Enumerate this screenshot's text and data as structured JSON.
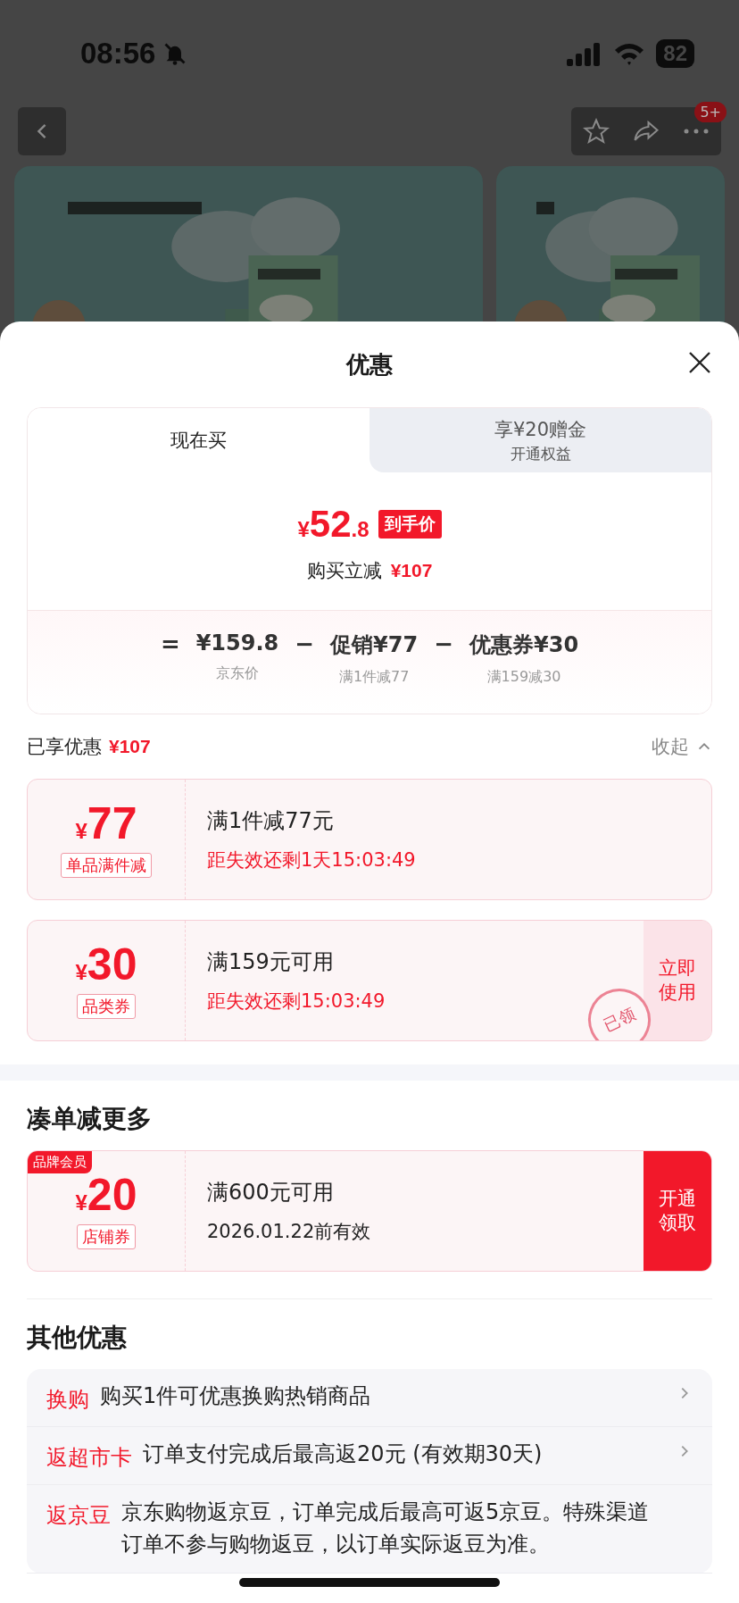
{
  "status_bar": {
    "time": "08:56",
    "muted": true,
    "battery": "82"
  },
  "nav": {
    "badge": "5+"
  },
  "sheet": {
    "title": "优惠",
    "price_tabs": [
      {
        "label": "现在买",
        "selected": true
      },
      {
        "label": "享¥20赠金",
        "sublabel": "开通权益",
        "selected": false
      }
    ],
    "final_price": {
      "currency": "¥",
      "integer": "52",
      "decimal": ".8",
      "tag": "到手价"
    },
    "saving": {
      "label": "购买立减",
      "amount": "¥107"
    },
    "breakdown": [
      {
        "operator": "=",
        "value": "¥159.8",
        "note": "京东价"
      },
      {
        "operator": "−",
        "value": "促销¥77",
        "note": "满1件减77"
      },
      {
        "operator": "−",
        "value": "优惠券¥30",
        "note": "满159减30"
      }
    ],
    "applied": {
      "label": "已享优惠",
      "amount": "¥107",
      "toggle": "收起",
      "expanded": true
    },
    "coupons": [
      {
        "currency": "¥",
        "amount": "77",
        "tag": "单品满件减",
        "title": "满1件减77元",
        "subtitle": "距失效还剩1天15:03:49",
        "urgent": true
      },
      {
        "currency": "¥",
        "amount": "30",
        "tag": "品类券",
        "title": "满159元可用",
        "subtitle": "距失效还剩15:03:49",
        "urgent": true,
        "stamp": "已领",
        "action": {
          "label": "立即使用",
          "kind": "light"
        }
      }
    ],
    "more_title": "凑单减更多",
    "more_coupons": [
      {
        "currency": "¥",
        "amount": "20",
        "tag": "店铺券",
        "badge": "品牌会员",
        "title": "满600元可用",
        "subtitle": "2026.01.22前有效",
        "urgent": false,
        "action": {
          "label": "开通领取",
          "kind": "solid"
        }
      }
    ],
    "other_title": "其他优惠",
    "other_offers": [
      {
        "label": "换购",
        "text": "购买1件可优惠换购热销商品",
        "arrow": true
      },
      {
        "label": "返超市卡",
        "text": "订单支付完成后最高返20元 (有效期30天)",
        "arrow": true
      },
      {
        "label": "返京豆",
        "text": "京东购物返京豆，订单完成后最高可返5京豆。特殊渠道订单不参与购物返豆，以订单实际返豆为准。",
        "arrow": false
      }
    ]
  }
}
